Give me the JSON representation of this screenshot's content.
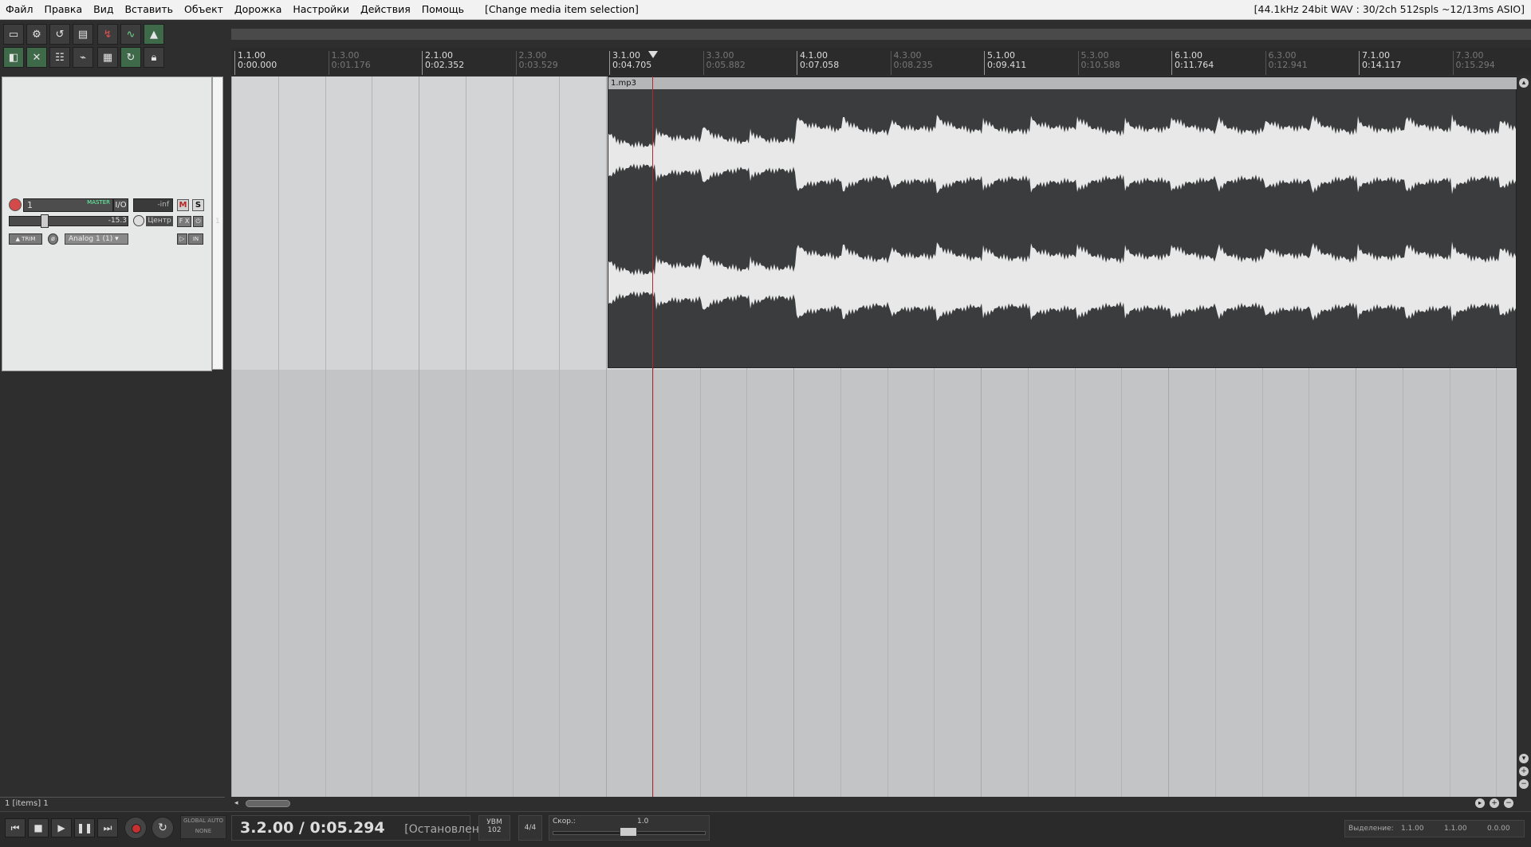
{
  "menu": {
    "items": [
      "Файл",
      "Правка",
      "Вид",
      "Вставить",
      "Объект",
      "Дорожка",
      "Настройки",
      "Действия",
      "Помощь"
    ],
    "last_action": "[Change media item selection]",
    "device_info": "[44.1kHz 24bit WAV : 30/2ch 512spls ~12/13ms ASIO]"
  },
  "toolbar": {
    "icons": [
      "new-project-icon",
      "project-settings-icon",
      "undo-redo-icon",
      "save-icon",
      "ripple-edit-icon",
      "envelope-icon",
      "metronome-icon",
      "snap-icon",
      "auto-crossfade-icon",
      "grouping-icon",
      "envelope-points-icon",
      "grid-icon",
      "loop-icon",
      "lock-icon"
    ]
  },
  "track": {
    "number": "1",
    "master_send": "MASTER",
    "io_label": "I/O",
    "meter_value": "-inf",
    "mute_label": "M",
    "solo_label": "S",
    "volume": "-15.3",
    "pan": "Центр",
    "fx_label": "F X",
    "trim_label": "TRIM",
    "input": "Analog 1 (1)",
    "in_label": "IN",
    "index_side": "1"
  },
  "ruler": {
    "marks": [
      {
        "bar": "1.1.00",
        "time": "0:00.000",
        "minor": false
      },
      {
        "bar": "1.3.00",
        "time": "0:01.176",
        "minor": true
      },
      {
        "bar": "2.1.00",
        "time": "0:02.352",
        "minor": false
      },
      {
        "bar": "2.3.00",
        "time": "0:03.529",
        "minor": true
      },
      {
        "bar": "3.1.00",
        "time": "0:04.705",
        "minor": false
      },
      {
        "bar": "3.3.00",
        "time": "0:05.882",
        "minor": true
      },
      {
        "bar": "4.1.00",
        "time": "0:07.058",
        "minor": false
      },
      {
        "bar": "4.3.00",
        "time": "0:08.235",
        "minor": true
      },
      {
        "bar": "5.1.00",
        "time": "0:09.411",
        "minor": false
      },
      {
        "bar": "5.3.00",
        "time": "0:10.588",
        "minor": true
      },
      {
        "bar": "6.1.00",
        "time": "0:11.764",
        "minor": false
      },
      {
        "bar": "6.3.00",
        "time": "0:12.941",
        "minor": true
      },
      {
        "bar": "7.1.00",
        "time": "0:14.117",
        "minor": false
      },
      {
        "bar": "7.3.00",
        "time": "0:15.294",
        "minor": true
      }
    ]
  },
  "item": {
    "name": "1.mp3"
  },
  "status": {
    "items_count": "1 [items] 1"
  },
  "transport": {
    "position": "3.2.00 / 0:05.294",
    "state": "[Остановлено]",
    "global_auto_line1": "GLOBAL AUTO",
    "global_auto_line2": "NONE",
    "bpm_label": "УВМ",
    "bpm_value": "102",
    "time_sig": "4/4",
    "rate_label": "Скор.:",
    "rate_value": "1.0",
    "selection_label": "Выделение:",
    "selection_start": "1.1.00",
    "selection_end": "1.1.00",
    "selection_length": "0.0.00"
  }
}
